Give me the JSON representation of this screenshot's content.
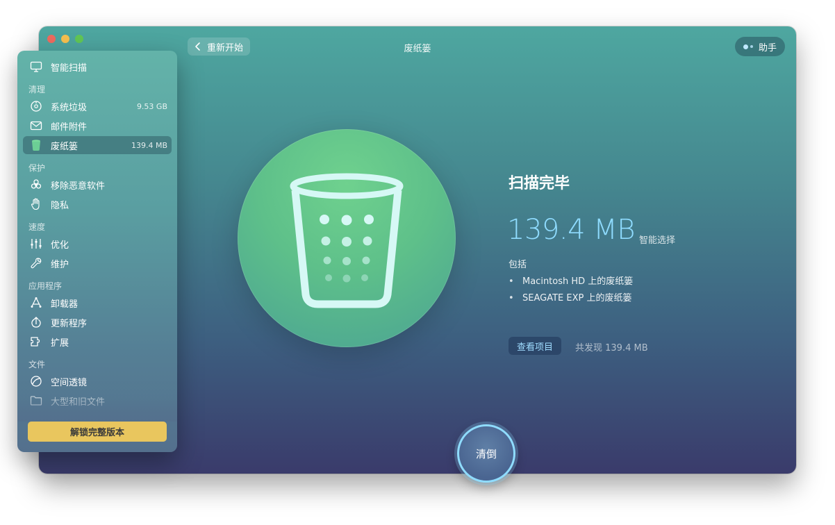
{
  "window": {
    "title": "废纸篓",
    "back_label": "重新开始",
    "assistant_label": "助手"
  },
  "sidebar": {
    "smart_scan": "智能扫描",
    "sections": {
      "clean": "清理",
      "protect": "保护",
      "speed": "速度",
      "apps": "应用程序",
      "files": "文件"
    },
    "items": [
      {
        "label": "系统垃圾",
        "value": "9.53 GB",
        "icon": "disk-icon"
      },
      {
        "label": "邮件附件",
        "value": "",
        "icon": "mail-icon"
      },
      {
        "label": "废纸篓",
        "value": "139.4 MB",
        "icon": "trash-icon",
        "active": true
      },
      {
        "label": "移除恶意软件",
        "value": "",
        "icon": "biohazard-icon"
      },
      {
        "label": "隐私",
        "value": "",
        "icon": "hand-icon"
      },
      {
        "label": "优化",
        "value": "",
        "icon": "sliders-icon"
      },
      {
        "label": "维护",
        "value": "",
        "icon": "wrench-icon"
      },
      {
        "label": "卸载器",
        "value": "",
        "icon": "uninstaller-icon"
      },
      {
        "label": "更新程序",
        "value": "",
        "icon": "update-icon"
      },
      {
        "label": "扩展",
        "value": "",
        "icon": "extension-icon"
      },
      {
        "label": "空间透镜",
        "value": "",
        "icon": "lens-icon"
      },
      {
        "label": "大型和旧文件",
        "value": "",
        "icon": "folder-icon"
      }
    ],
    "unlock_label": "解锁完整版本"
  },
  "result": {
    "title": "扫描完毕",
    "size": "139.4 MB",
    "smart_select": "智能选择",
    "includes_label": "包括",
    "includes": [
      "Macintosh HD 上的废纸篓",
      "SEAGATE EXP 上的废纸篓"
    ],
    "bullet": "•",
    "view_items_label": "查看项目",
    "found_text": "共发现 139.4 MB"
  },
  "clean_button_label": "清倒",
  "colors": {
    "accent_blue": "#8fdcff",
    "unlock_yellow": "#e9c65e",
    "traffic_red": "#ed6a5e",
    "traffic_yellow": "#f5bf4f",
    "traffic_green": "#61c554"
  }
}
